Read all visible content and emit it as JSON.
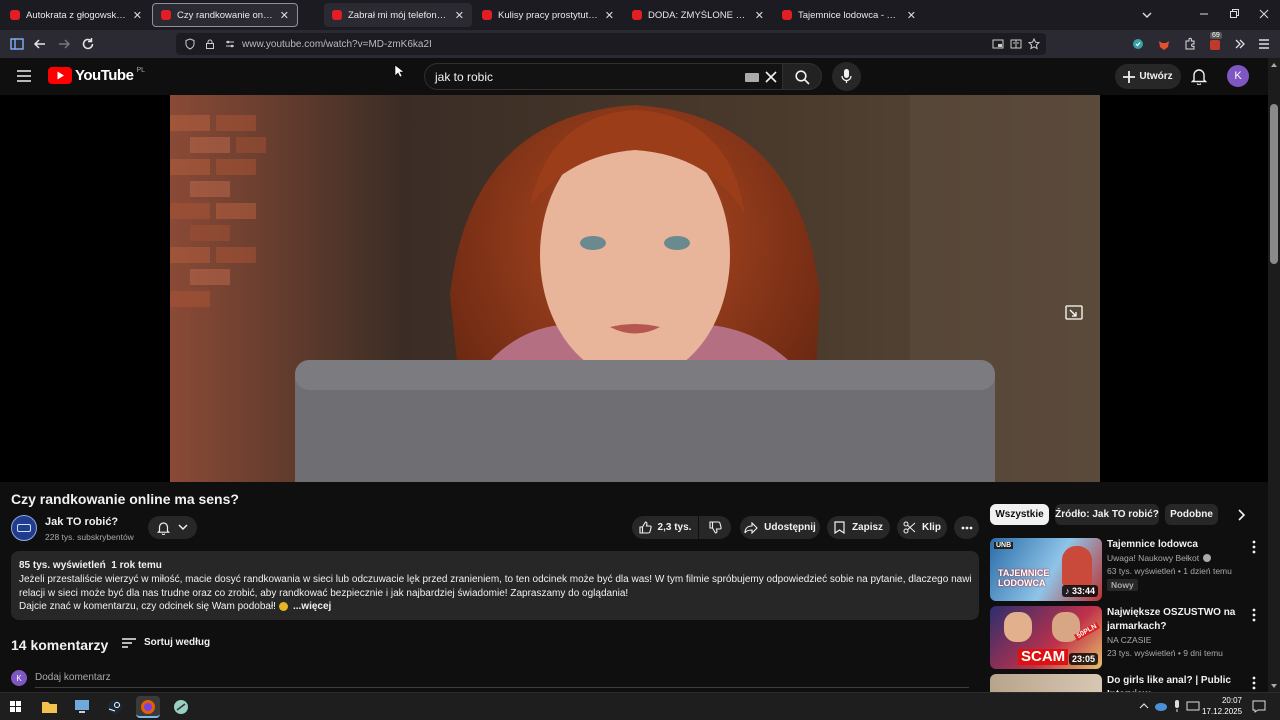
{
  "browser": {
    "tabs": [
      {
        "title": "Autokrata z głogowskiej huty w"
      },
      {
        "title": "Czy randkowanie online ma sen"
      },
      {
        "title": "Zabrał mi mój telefon w nocy"
      },
      {
        "title": "Kulisy pracy prostytutki. Cała p"
      },
      {
        "title": "DODA: ZMYŚLONE ŻYCIE I KAR"
      },
      {
        "title": "Tajemnice lodowca - YouTube"
      }
    ],
    "url": "www.youtube.com/watch?v=MD-zmK6ka2I",
    "ext_badge": "69"
  },
  "youtube": {
    "logo_text": "YouTube",
    "region": "PL",
    "search_value": "jak to robic",
    "create_label": "Utwórz",
    "avatar_letter": "K"
  },
  "video": {
    "title": "Czy randkowanie online ma sens?",
    "channel": "Jak TO robić?",
    "subscribers": "228 tys. subskrybentów",
    "likes": "2,3 tys.",
    "share_label": "Udostępnij",
    "save_label": "Zapisz",
    "clip_label": "Klip",
    "views": "85 tys. wyświetleń",
    "age": "1 rok temu",
    "description_lines": [
      "Jeżeli przestaliście wierzyć w miłość, macie dosyć randkowania w sieci lub odczuwacie lęk przed zranieniem, to ten odcinek może być dla was! W tym filmie spróbujemy odpowiedzieć sobie na pytanie, dlaczego nawiązywanie",
      "relacji w sieci może być dla nas trudne oraz co zrobić, aby randkować bezpiecznie i jak najbardziej świadomie! Zapraszamy do oglądania!",
      "Dajcie znać w komentarzu, czy odcinek się Wam podobał!"
    ],
    "more_label": "...więcej"
  },
  "comments": {
    "count_label": "14 komentarzy",
    "sort_label": "Sortuj według",
    "add_placeholder": "Dodaj komentarz",
    "avatar_letter": "K"
  },
  "chips": [
    "Wszystkie",
    "Źródło: Jak TO robić?",
    "Podobne"
  ],
  "recommendations": [
    {
      "title": "Tajemnice lodowca",
      "channel": "Uwaga! Naukowy Bełkot",
      "meta": "63 tys. wyświetleń • 1 dzień temu",
      "badge": "Nowy",
      "duration": "33:44",
      "thumb_text": "TAJEMNICE LODOWCA",
      "thumb_corner": "UNB"
    },
    {
      "title": "Największe OSZUSTWO na jarmarkach?",
      "channel": "NA CZASIE",
      "meta": "23 tys. wyświetleń • 9 dni temu",
      "duration": "23:05",
      "thumb_text": "SCAM",
      "thumb_corner": "50PLN"
    },
    {
      "title": "Do girls like anal? | Public Interview"
    }
  ],
  "taskbar": {
    "time": "20:07",
    "date": "17.12.2025"
  }
}
